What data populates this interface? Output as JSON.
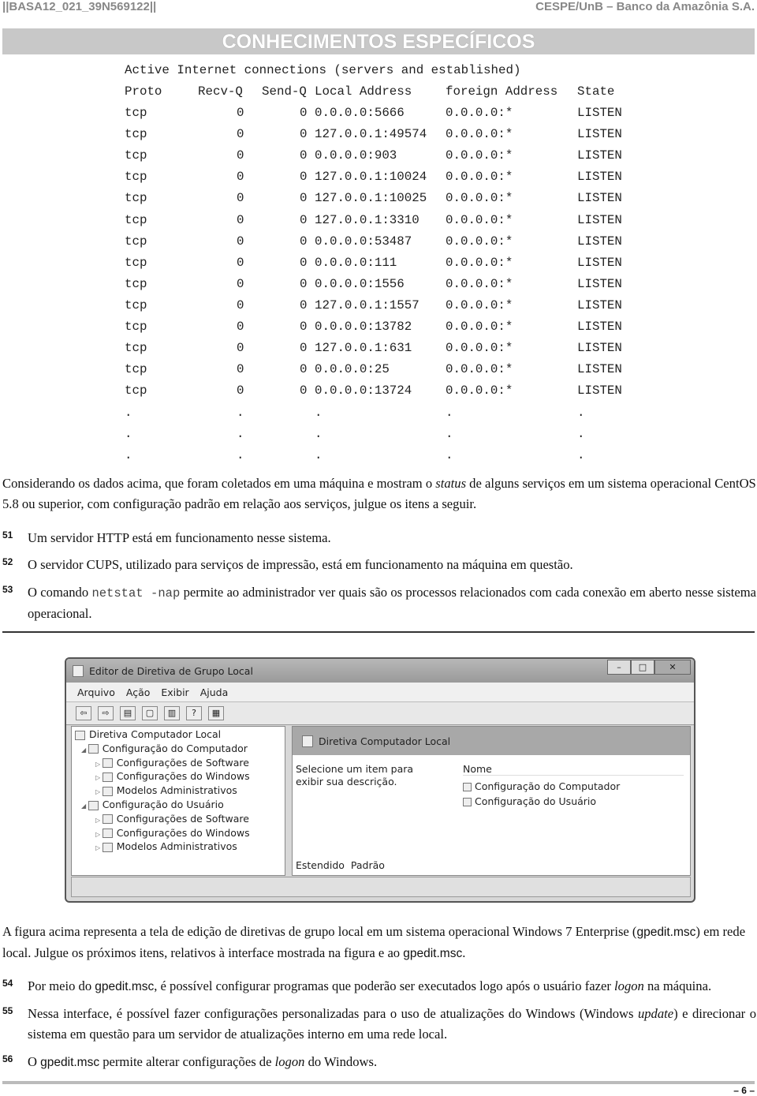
{
  "header": {
    "left": "||BASA12_021_39N569122||",
    "right": "CESPE/UnB – Banco da Amazônia S.A."
  },
  "section_title": "CONHECIMENTOS ESPECÍFICOS",
  "netstat": {
    "title": "Active Internet connections (servers and established)",
    "columns": [
      "Proto",
      "Recv-Q",
      "Send-Q",
      "Local Address",
      "foreign Address",
      "State"
    ],
    "rows": [
      [
        "tcp",
        "0",
        "0",
        "0.0.0.0:5666",
        "0.0.0.0:*",
        "LISTEN"
      ],
      [
        "tcp",
        "0",
        "0",
        "127.0.0.1:49574",
        "0.0.0.0:*",
        "LISTEN"
      ],
      [
        "tcp",
        "0",
        "0",
        "0.0.0.0:903",
        "0.0.0.0:*",
        "LISTEN"
      ],
      [
        "tcp",
        "0",
        "0",
        "127.0.0.1:10024",
        "0.0.0.0:*",
        "LISTEN"
      ],
      [
        "tcp",
        "0",
        "0",
        "127.0.0.1:10025",
        "0.0.0.0:*",
        "LISTEN"
      ],
      [
        "tcp",
        "0",
        "0",
        "127.0.0.1:3310",
        "0.0.0.0:*",
        "LISTEN"
      ],
      [
        "tcp",
        "0",
        "0",
        "0.0.0.0:53487",
        "0.0.0.0:*",
        "LISTEN"
      ],
      [
        "tcp",
        "0",
        "0",
        "0.0.0.0:111",
        "0.0.0.0:*",
        "LISTEN"
      ],
      [
        "tcp",
        "0",
        "0",
        "0.0.0.0:1556",
        "0.0.0.0:*",
        "LISTEN"
      ],
      [
        "tcp",
        "0",
        "0",
        "127.0.0.1:1557",
        "0.0.0.0:*",
        "LISTEN"
      ],
      [
        "tcp",
        "0",
        "0",
        "0.0.0.0:13782",
        "0.0.0.0:*",
        "LISTEN"
      ],
      [
        "tcp",
        "0",
        "0",
        "127.0.0.1:631",
        "0.0.0.0:*",
        "LISTEN"
      ],
      [
        "tcp",
        "0",
        "0",
        "0.0.0.0:25",
        "0.0.0.0:*",
        "LISTEN"
      ],
      [
        "tcp",
        "0",
        "0",
        "0.0.0.0:13724",
        "0.0.0.0:*",
        "LISTEN"
      ]
    ],
    "ellipsis": "."
  },
  "intro1": {
    "a": "Considerando os dados acima, que foram coletados em uma máquina e mostram o ",
    "em": "status",
    "b": " de alguns serviços em um sistema operacional CentOS 5.8 ou superior, com configuração padrão em relação aos serviços, julgue os itens a seguir."
  },
  "q51": {
    "n": "51",
    "text": "Um servidor HTTP está em funcionamento nesse sistema."
  },
  "q52": {
    "n": "52",
    "text": "O servidor CUPS, utilizado para serviços de impressão, está em funcionamento na máquina em questão."
  },
  "q53": {
    "n": "53",
    "a": "O comando ",
    "code": "netstat -nap",
    "b": " permite ao administrador ver quais são os processos relacionados com cada conexão em aberto nesse sistema operacional."
  },
  "window": {
    "title": "Editor de Diretiva de Grupo Local",
    "menu": [
      "Arquivo",
      "Ação",
      "Exibir",
      "Ajuda"
    ],
    "tree": [
      "Diretiva Computador Local",
      "Configuração do Computador",
      "Configurações de Software",
      "Configurações do Windows",
      "Modelos Administrativos",
      "Configuração do Usuário",
      "Configurações de Software",
      "Configurações do Windows",
      "Modelos Administrativos"
    ],
    "right_header": "Diretiva Computador Local",
    "description": "Selecione um item para exibir sua descrição.",
    "list_header": "Nome",
    "list": [
      "Configuração do Computador",
      "Configuração do Usuário"
    ],
    "tabs": [
      "Estendido",
      "Padrão"
    ]
  },
  "intro2": {
    "a": "A figura acima representa a tela de edição de diretivas de grupo local em um sistema operacional Windows 7 Enterprise (",
    "s1": "gpedit.msc",
    "b": ") em rede local. Julgue os próximos itens, relativos à interface mostrada na figura e ao ",
    "s2": "gpedit.msc",
    "c": "."
  },
  "q54": {
    "n": "54",
    "a": "Por meio do ",
    "s": "gpedit.msc",
    "b": ", é possível configurar programas que poderão ser executados logo após o usuário fazer ",
    "em": "logon",
    "c": " na máquina."
  },
  "q55": {
    "n": "55",
    "a": "Nessa interface, é possível fazer configurações personalizadas para o uso de atualizações do Windows (Windows ",
    "em": "update",
    "b": ") e direcionar o sistema em questão para um servidor de atualizações interno em uma rede local."
  },
  "q56": {
    "n": "56",
    "a": "O ",
    "s": "gpedit.msc",
    "b": " permite alterar configurações de ",
    "em": "logon",
    "c": " do Windows."
  },
  "page_number": "– 6 –"
}
